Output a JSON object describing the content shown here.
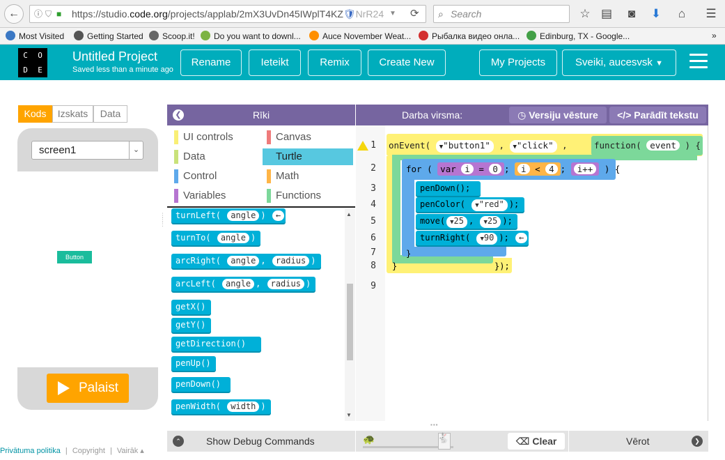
{
  "browser": {
    "url_prefix": "https://studio.",
    "url_domain": "code.org",
    "url_rest": "/projects/applab/2mX3UvDn45IWplT4KZ",
    "url_tail": "NrR24",
    "search_placeholder": "Search",
    "bookmarks": [
      {
        "label": "Most Visited",
        "color": "#3b78c4"
      },
      {
        "label": "Getting Started",
        "color": "#555555"
      },
      {
        "label": "Scoop.it!",
        "color": "#666666"
      },
      {
        "label": "Do you want to downl...",
        "color": "#7cb342"
      },
      {
        "label": "Auce November Weat...",
        "color": "#ff8f00"
      },
      {
        "label": "Рыбалка видео онла...",
        "color": "#d32f2f"
      },
      {
        "label": "Edinburg, TX - Google...",
        "color": "#43a047"
      }
    ],
    "more": "»"
  },
  "header": {
    "logo": [
      "C",
      "O",
      "D",
      "E"
    ],
    "title": "Untitled Project",
    "saved": "Saved less than a minute ago",
    "buttons": [
      "Rename",
      "Ieteikt",
      "Remix",
      "Create New"
    ],
    "my_projects": "My Projects",
    "user": "Sveiki, aucesvsk"
  },
  "left": {
    "tabs": [
      "Kods",
      "Izskats",
      "Data"
    ],
    "screen": "screen1",
    "app_button": "Button",
    "run": "Palaist"
  },
  "footer": {
    "privacy": "Privātuma politika",
    "sep": "|",
    "copyright": "Copyright",
    "more": "Vairāk ▴"
  },
  "toolbox": {
    "title": "Rīki",
    "categories": [
      {
        "label": "UI controls",
        "color": "#f9ef75"
      },
      {
        "label": "Canvas",
        "color": "#ef7b7b"
      },
      {
        "label": "Data",
        "color": "#c9e27a"
      },
      {
        "label": "Turtle",
        "color": "#57c8e0"
      },
      {
        "label": "Control",
        "color": "#5ea9eb"
      },
      {
        "label": "Math",
        "color": "#ffb547"
      },
      {
        "label": "Variables",
        "color": "#b675d1"
      },
      {
        "label": "Functions",
        "color": "#7cd89a"
      }
    ],
    "blocks": [
      {
        "name": "turnLeft(",
        "args": [
          "angle"
        ],
        "close": ")",
        "arrow": "←"
      },
      {
        "name": "turnTo(",
        "args": [
          "angle"
        ],
        "close": ")"
      },
      {
        "name": "arcRight(",
        "args": [
          "angle",
          "radius"
        ],
        "close": ")"
      },
      {
        "name": "arcLeft(",
        "args": [
          "angle",
          "radius"
        ],
        "close": ")"
      },
      {
        "name": "getX()",
        "args": [],
        "close": ""
      },
      {
        "name": "getY()",
        "args": [],
        "close": ""
      },
      {
        "name": "getDirection()",
        "args": [],
        "close": ""
      },
      {
        "name": "penUp()",
        "args": [],
        "close": ""
      },
      {
        "name": "penDown()",
        "args": [],
        "close": ""
      },
      {
        "name": "penWidth(",
        "args": [
          "width"
        ],
        "close": ")"
      }
    ]
  },
  "workspace": {
    "title": "Darba virsma:",
    "history": "Versiju vēsture",
    "show_text": "Parādīt tekstu",
    "line_numbers": [
      "1",
      "2",
      "3",
      "4",
      "5",
      "6",
      "7",
      "8",
      "9"
    ],
    "code": {
      "onevent": "onEvent(",
      "arg1": "\"button1\"",
      "comma": ",",
      "arg2": "\"click\"",
      "function": "function(",
      "event": "event",
      "close_fn": ") {",
      "for": "for (",
      "var": "var",
      "i": "i",
      "eq": "=",
      "zero": "0",
      "semi": ";",
      "lt": "<",
      "four": "4",
      "iplus": "i++",
      "for_close": ") {",
      "pendown": "penDown();",
      "pencolor": "penColor(",
      "red": "\"red\"",
      "pencolor_close": ");",
      "move": "move(",
      "m1": "25",
      "m2": "25",
      "move_close": ");",
      "turnright": "turnRight(",
      "deg": "90",
      "turn_close": ");",
      "arrow": "←",
      "brace": "}",
      "end": "});"
    }
  },
  "bottom": {
    "debug": "Show Debug Commands",
    "clear": "Clear",
    "watch": "Vērot"
  }
}
